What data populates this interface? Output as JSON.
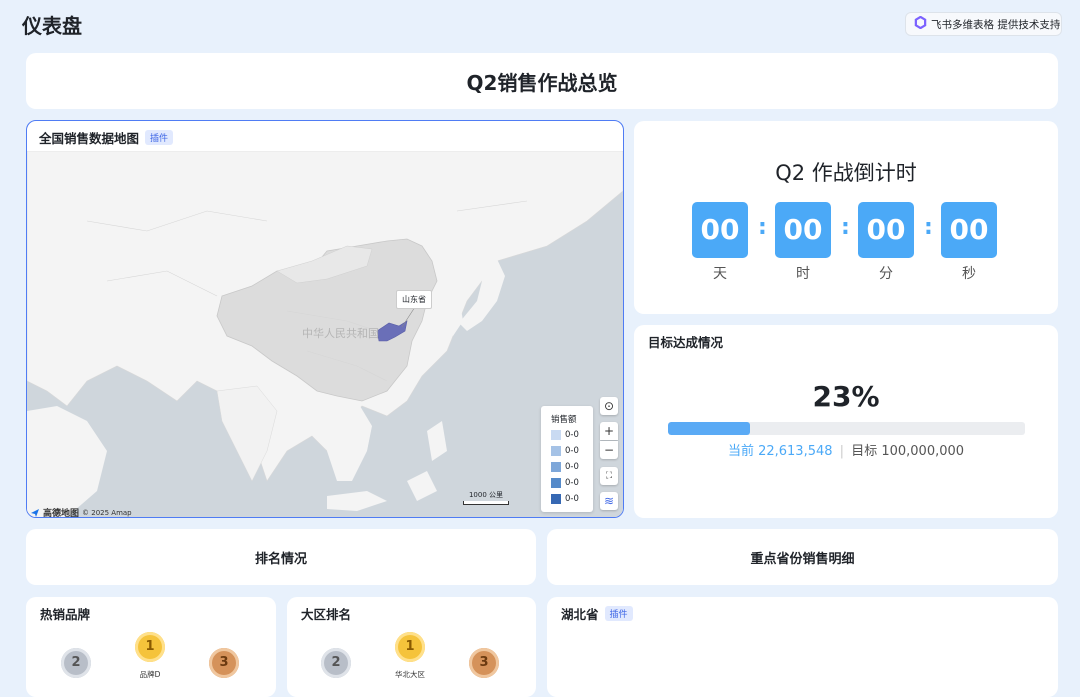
{
  "page": {
    "title": "仪表盘"
  },
  "support_badge": {
    "text": "飞书多维表格 提供技术支持"
  },
  "header": {
    "title": "Q2销售作战总览"
  },
  "map_card": {
    "title": "全国销售数据地图",
    "tag": "插件",
    "country_label": "中华人民共和国",
    "province_label": "山东省",
    "legend": {
      "title": "销售额",
      "items": [
        {
          "label": "0-0",
          "color": "#c9daf2"
        },
        {
          "label": "0-0",
          "color": "#a5c2e6"
        },
        {
          "label": "0-0",
          "color": "#7ea7d9"
        },
        {
          "label": "0-0",
          "color": "#558ac9"
        },
        {
          "label": "0-0",
          "color": "#3668b3"
        }
      ]
    },
    "controls": {
      "compass": "⊙",
      "zoom_in": "+",
      "zoom_out": "−",
      "fullscreen": "⛶",
      "layers": "≋"
    },
    "scale": "1000 公里",
    "logo": {
      "name": "高德地图",
      "copyright": "© 2025 Amap"
    }
  },
  "countdown": {
    "title": "Q2 作战倒计时",
    "units": [
      {
        "value": "00",
        "label": "天"
      },
      {
        "value": "00",
        "label": "时"
      },
      {
        "value": "00",
        "label": "分"
      },
      {
        "value": "00",
        "label": "秒"
      }
    ],
    "separator": ":"
  },
  "goal": {
    "title": "目标达成情况",
    "percent_text": "23%",
    "progress": 0.23,
    "current": "当前 22,613,548",
    "target": "目标 100,000,000",
    "separator": "|"
  },
  "sections": {
    "ranking": "排名情况",
    "province_detail": "重点省份销售明细"
  },
  "hot_brands": {
    "title": "热销品牌",
    "medals": [
      {
        "rank": "2",
        "label": ""
      },
      {
        "rank": "1",
        "label": "品牌D"
      },
      {
        "rank": "3",
        "label": ""
      }
    ]
  },
  "region_rank": {
    "title": "大区排名",
    "medals": [
      {
        "rank": "2",
        "label": ""
      },
      {
        "rank": "1",
        "label": "华北大区"
      },
      {
        "rank": "3",
        "label": ""
      }
    ]
  },
  "province_card": {
    "title": "湖北省",
    "tag": "插件"
  },
  "colors": {
    "accent": "#4ba9f7",
    "map_highlight": "#6a6fb8",
    "border_active": "#4f7cf4"
  }
}
